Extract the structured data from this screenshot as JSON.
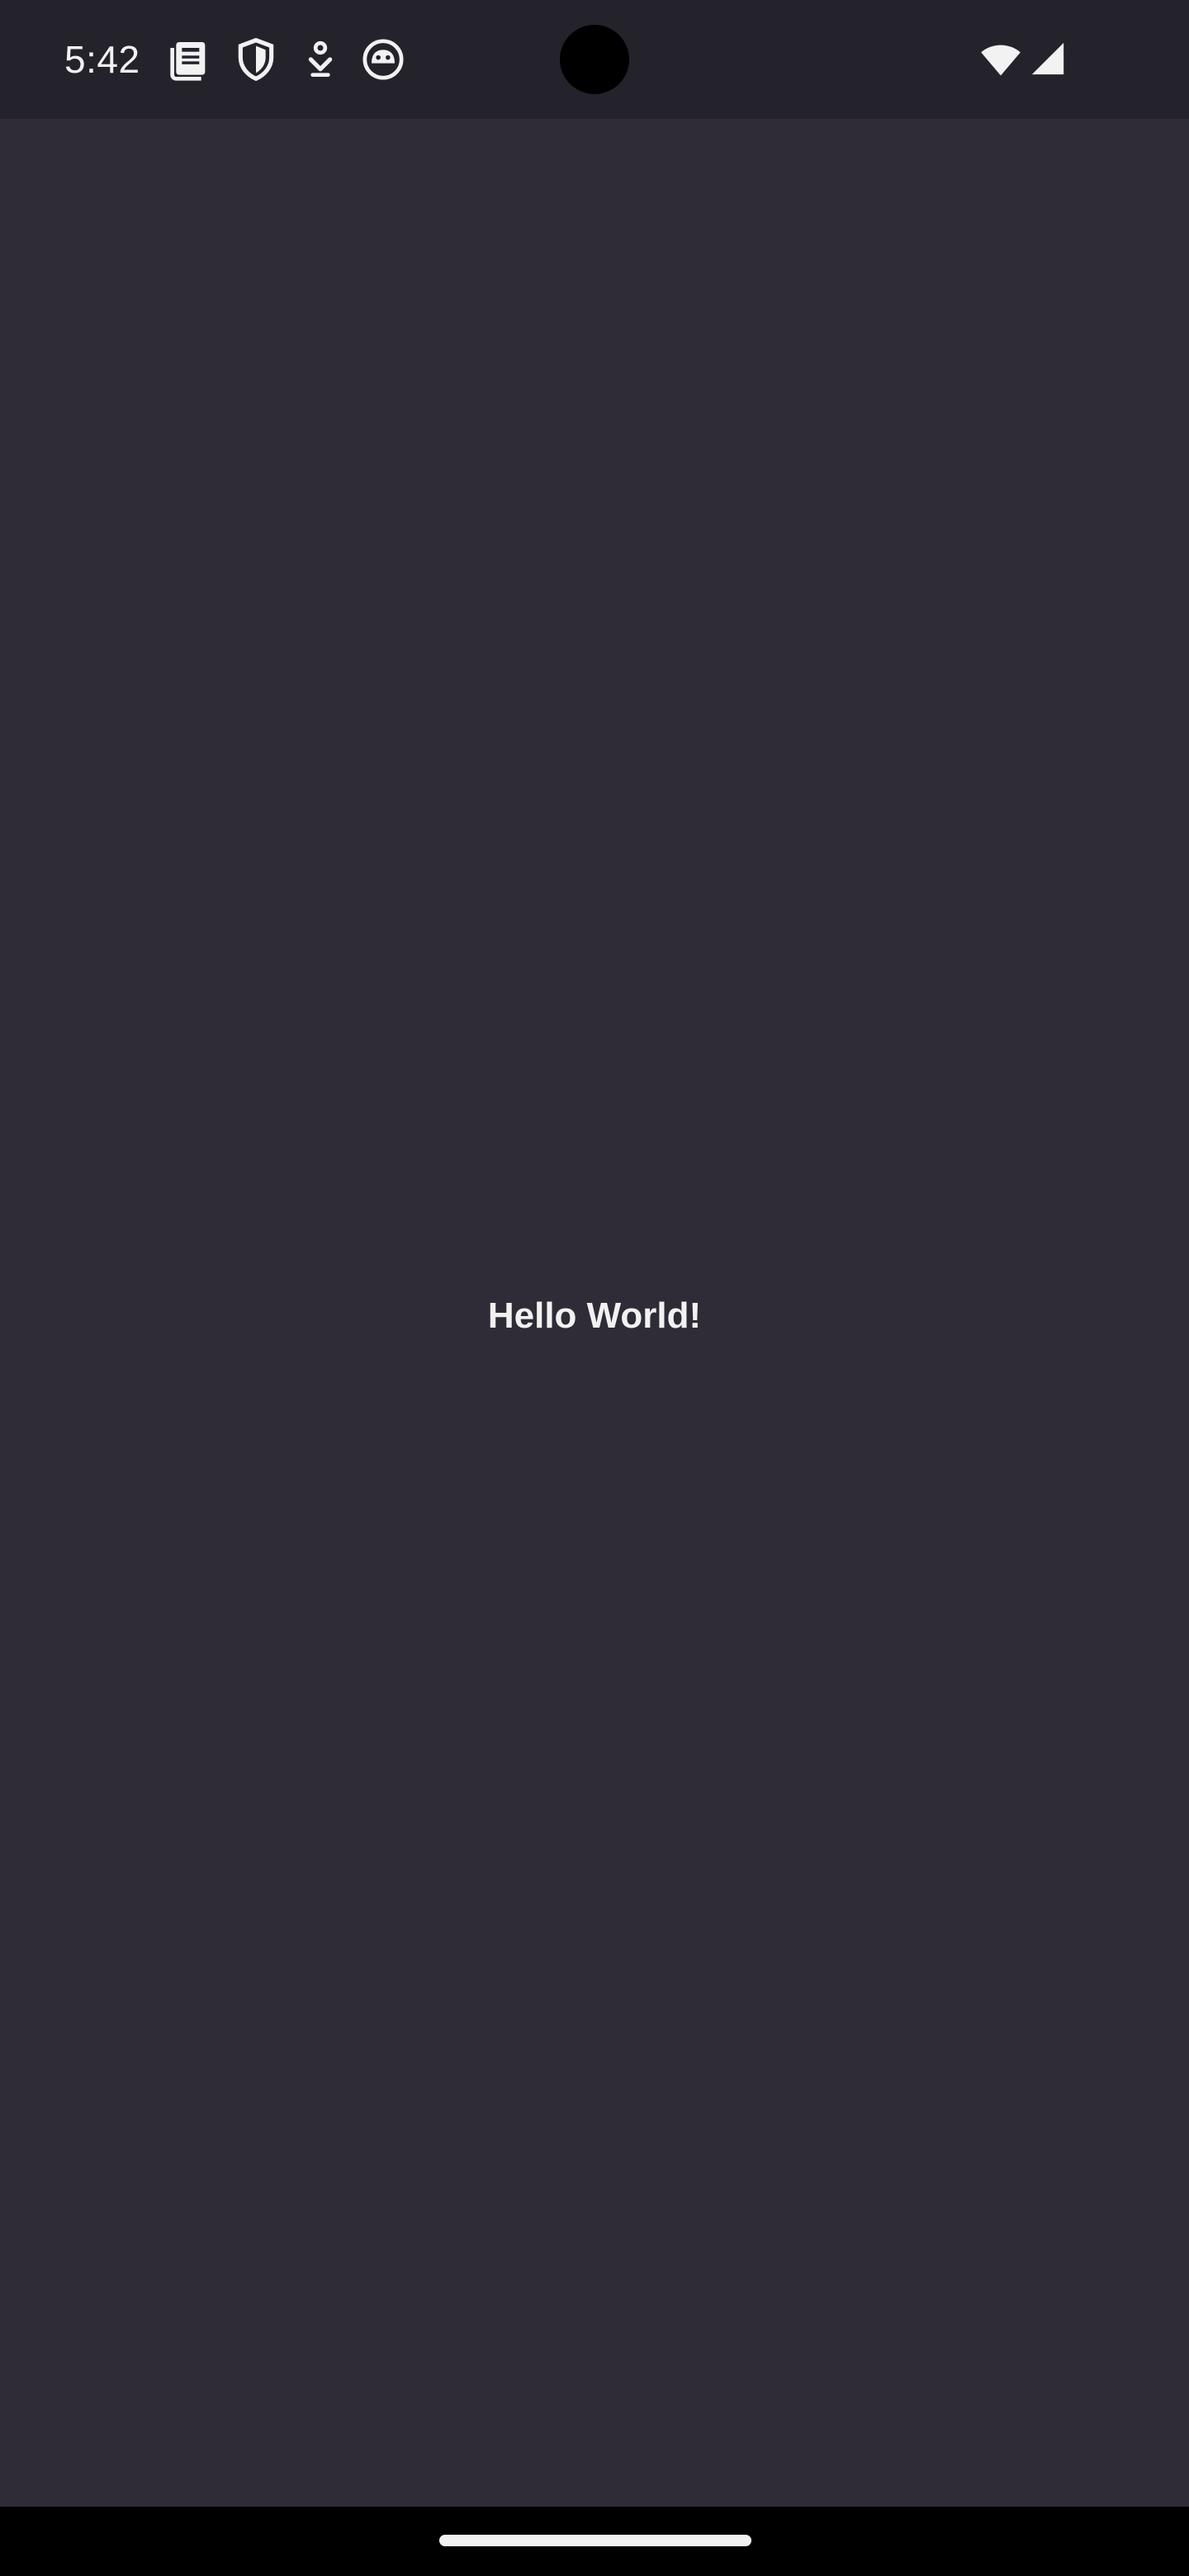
{
  "status_bar": {
    "time": "5:42",
    "left_icons": [
      "news-icon",
      "shield-icon",
      "download-icon",
      "face-icon"
    ],
    "right_icons": [
      "wifi-icon",
      "cellular-signal-icon"
    ]
  },
  "main": {
    "greeting": "Hello World!"
  },
  "colors": {
    "background": "#2f2c37",
    "status_bar": "#24232b",
    "nav_bar": "#000000",
    "text": "#f2f2f2"
  }
}
